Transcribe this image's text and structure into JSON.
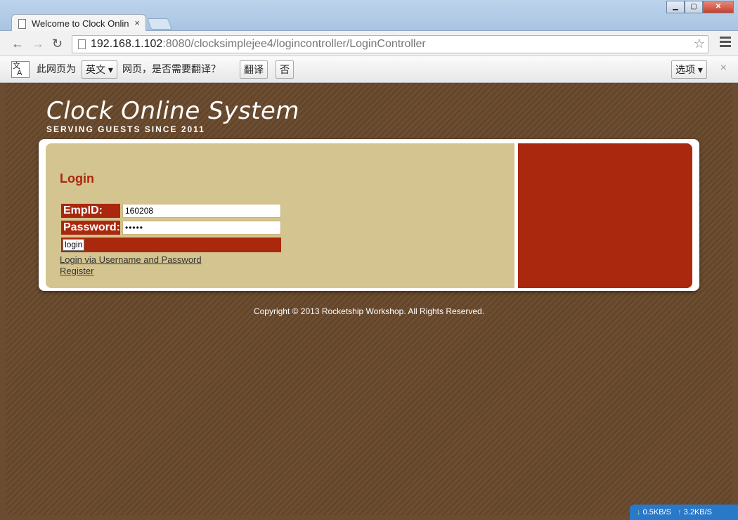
{
  "browser": {
    "tab_title": "Welcome to Clock Onlin",
    "close_glyph": "×",
    "url_host": "192.168.1.102",
    "url_rest": ":8080/clocksimplejee4/logincontroller/LoginController"
  },
  "translate_bar": {
    "prefix": "此网页为",
    "language": "英文",
    "question": "网页，是否需要翻译？",
    "translate_label": "翻译",
    "no_label": "否",
    "options_label": "选项",
    "close_glyph": "×"
  },
  "site": {
    "title": "Clock Online System",
    "tagline": "SERVING GUESTS SINCE 2011"
  },
  "login": {
    "heading": "Login",
    "empid_label": "EmpID:",
    "empid_value": "160208",
    "password_label": "Password:",
    "password_value": "•••••",
    "submit_label": "login",
    "link_username": "Login via Username and Password",
    "link_register": "Register"
  },
  "footer": {
    "copyright": "Copyright © 2013 Rocketship Workshop. All Rights Reserved."
  },
  "status": {
    "down_speed": "0.5KB/S",
    "up_speed": "3.2KB/S"
  },
  "colors": {
    "brand_red": "#a9280e",
    "panel_tan": "#d4c48f",
    "background_brown": "#6b4c32"
  },
  "icons": [
    "page-icon",
    "back-icon",
    "forward-icon",
    "reload-icon",
    "star-icon",
    "menu-icon",
    "translate-icon",
    "download-arrow-icon",
    "upload-arrow-icon"
  ]
}
